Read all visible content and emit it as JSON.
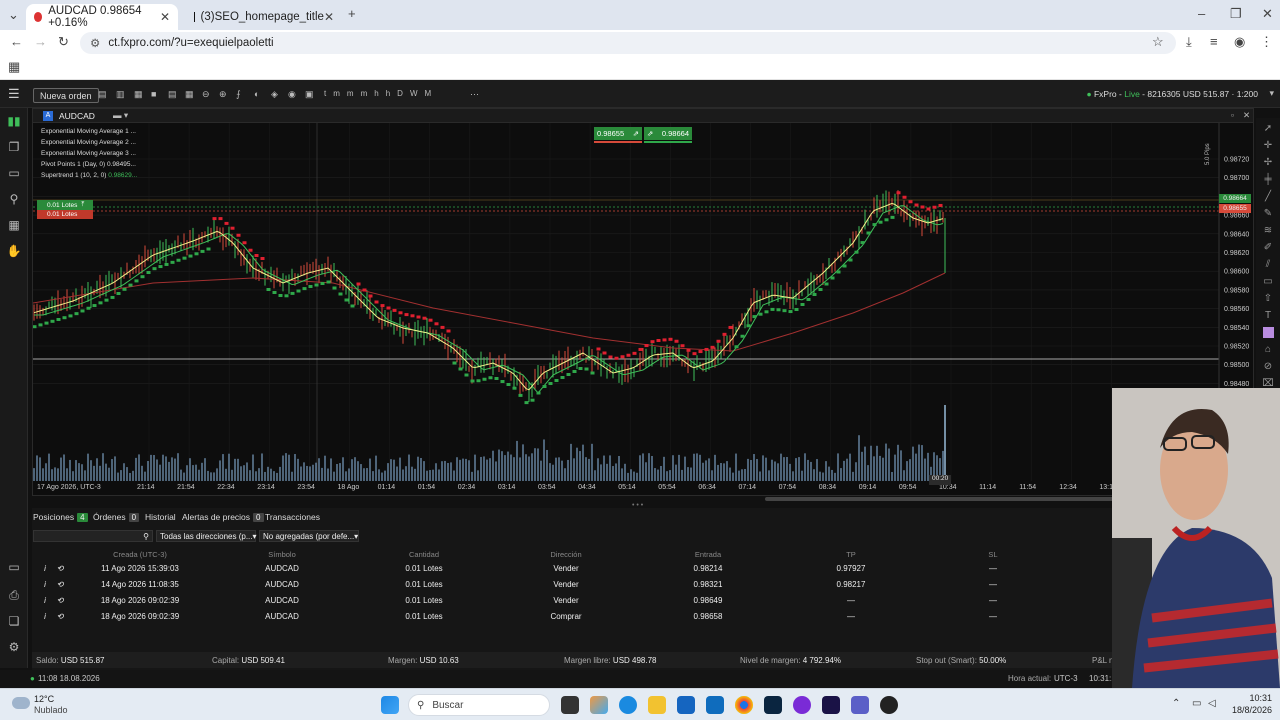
{
  "browser": {
    "tabs": [
      {
        "title": "AUDCAD 0.98654 +0.16%",
        "active": true
      },
      {
        "title": "(3)SEO_homepage_title",
        "active": false
      }
    ],
    "url": "ct.fxpro.com/?u=exequielpaoletti"
  },
  "platform": {
    "new_order": "Nueva orden",
    "timeframes": [
      "t",
      "m",
      "m",
      "m",
      "h",
      "h",
      "D",
      "W",
      "M"
    ],
    "account": {
      "broker": "FxPro",
      "mode": "Live",
      "id": "8216305",
      "balance": "USD 515.87",
      "leverage": "1:200"
    },
    "chart": {
      "symbol": "AUDCAD",
      "indicators": [
        {
          "label": "Exponential Moving Average 1",
          "value": "..."
        },
        {
          "label": "Exponential Moving Average 2",
          "value": "..."
        },
        {
          "label": "Exponential Moving Average 3",
          "value": "..."
        },
        {
          "label": "Pivot Points 1 (Day, 0)",
          "value": "0.98495..."
        },
        {
          "label": "Supertrend 1 (10, 2, 0)",
          "value": "0.98629..."
        }
      ],
      "sell_price": "0.98655",
      "buy_price": "0.98664",
      "positions_label_1": "0.01 Lotes",
      "positions_label_2": "0.01 Lotes",
      "pips_label": "5.0 Pips",
      "current_buy_tag": "0.98664",
      "current_sell_tag": "0.98655",
      "timer": "00:20",
      "price_axis": [
        "0.98720",
        "0.98700",
        "0.98680",
        "0.98660",
        "0.98640",
        "0.98620",
        "0.98600",
        "0.98580",
        "0.98560",
        "0.98540",
        "0.98520",
        "0.98500",
        "0.98480"
      ],
      "time_axis": [
        "17 Ago 2026, UTC-3",
        "21:14",
        "21:54",
        "22:34",
        "23:14",
        "23:54",
        "18 Ago",
        "01:14",
        "01:54",
        "02:34",
        "03:14",
        "03:54",
        "04:34",
        "05:14",
        "05:54",
        "06:34",
        "07:14",
        "07:54",
        "08:34",
        "09:14",
        "09:54",
        "10:34",
        "11:14",
        "11:54",
        "12:34",
        "13:1"
      ]
    },
    "panel": {
      "tabs": [
        {
          "label": "Posiciones",
          "count": "4"
        },
        {
          "label": "Órdenes",
          "count": "0"
        },
        {
          "label": "Historial",
          "count": ""
        },
        {
          "label": "Alertas de precios",
          "count": "0"
        },
        {
          "label": "Transacciones",
          "count": ""
        }
      ],
      "filter_direction": "Todas las direcciones (p...",
      "filter_group": "No agregadas (por defe...",
      "columns": [
        "Creada (UTC-3)",
        "Símbolo",
        "Cantidad",
        "Dirección",
        "Entrada",
        "TP",
        "SL"
      ],
      "rows": [
        {
          "created": "11 Ago 2026 15:39:03",
          "symbol": "AUDCAD",
          "qty": "0.01 Lotes",
          "dir": "Vender",
          "entry": "0.98214",
          "tp": "0.97927",
          "sl": "—"
        },
        {
          "created": "14 Ago 2026 11:08:35",
          "symbol": "AUDCAD",
          "qty": "0.01 Lotes",
          "dir": "Vender",
          "entry": "0.98321",
          "tp": "0.98217",
          "sl": "—"
        },
        {
          "created": "18 Ago 2026 09:02:39",
          "symbol": "AUDCAD",
          "qty": "0.01 Lotes",
          "dir": "Vender",
          "entry": "0.98649",
          "tp": "—",
          "sl": "—"
        },
        {
          "created": "18 Ago 2026 09:02:39",
          "symbol": "AUDCAD",
          "qty": "0.01 Lotes",
          "dir": "Comprar",
          "entry": "0.98658",
          "tp": "—",
          "sl": "—"
        }
      ],
      "summary": {
        "saldo_label": "Saldo:",
        "saldo": "USD 515.87",
        "capital_label": "Capital:",
        "capital": "USD 509.41",
        "margen_label": "Margen:",
        "margen": "USD 10.63",
        "margen_libre_label": "Margen libre:",
        "margen_libre": "USD 498.78",
        "nivel_label": "Nivel de margen:",
        "nivel": "4 792.94%",
        "stop_label": "Stop out (Smart):",
        "stop": "50.00%",
        "pl_label": "P&L n"
      }
    },
    "status": {
      "time": "11:08 18.08.2026",
      "hora_label": "Hora actual:",
      "tz": "UTC-3",
      "clock": "10:31:1"
    }
  },
  "taskbar": {
    "weather_temp": "12°C",
    "weather_desc": "Nublado",
    "search": "Buscar",
    "time": "10:31",
    "date": "18/8/2026"
  },
  "colors": {
    "accent_green": "#2fa84a",
    "accent_red": "#d64a3a",
    "chart_bg": "#0d0d0d"
  }
}
